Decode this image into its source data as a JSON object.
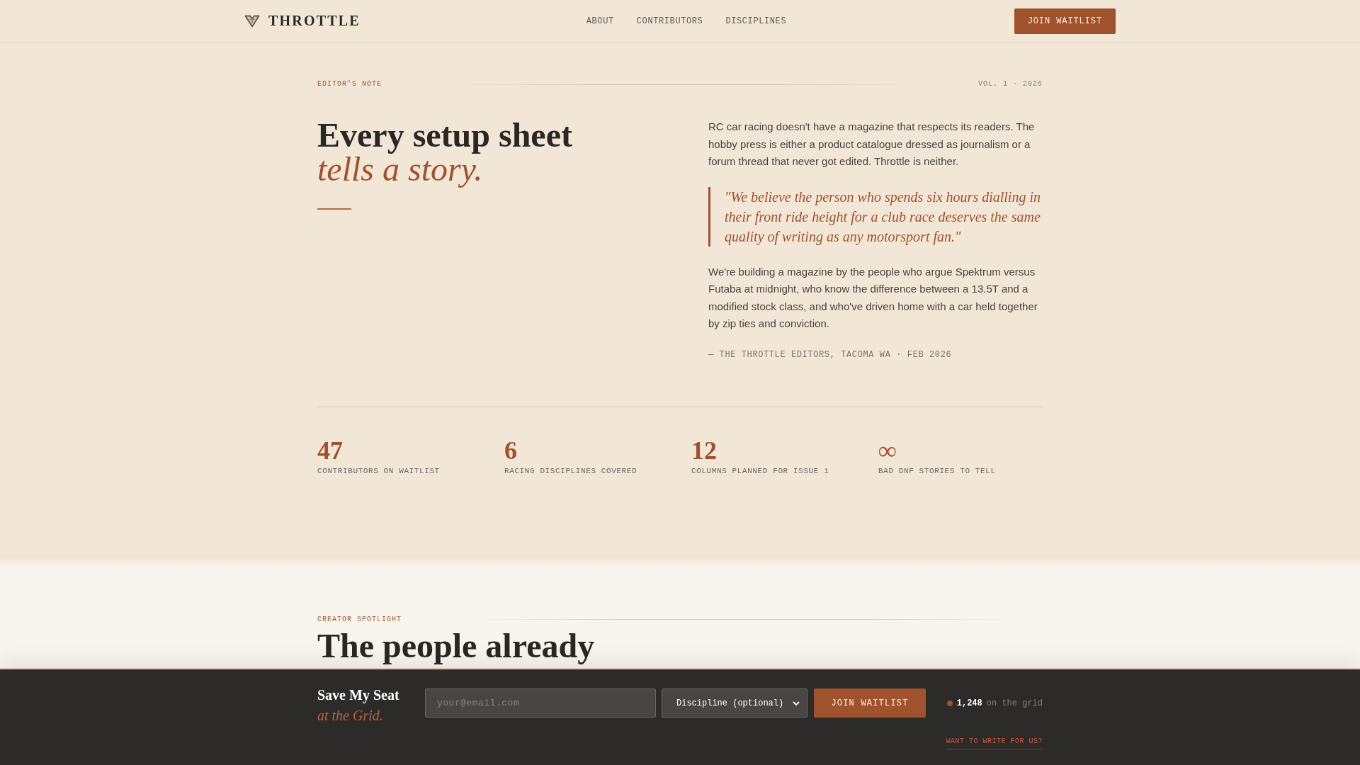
{
  "header": {
    "brand": "THROTTLE",
    "nav": [
      "ABOUT",
      "CONTRIBUTORS",
      "DISCIPLINES"
    ],
    "cta": "JOIN WAITLIST"
  },
  "editors_note": {
    "label": "EDITOR'S NOTE",
    "volume": "VOL. 1 · 2026",
    "headline": "Every setup sheet *tells a story.*",
    "body": [
      {
        "kind": "paragraph",
        "text": "RC car racing doesn't have a magazine that respects its readers. The hobby press is either a product catalogue dressed as journalism or a forum thread that never got edited. Throttle is neither."
      },
      {
        "kind": "quote",
        "text": "\"We believe the person who spends six hours dialling in their front ride height for a club race deserves the same quality of writing as any motorsport fan.\""
      },
      {
        "kind": "paragraph",
        "text": "We're building a magazine by the people who argue Spektrum versus Futaba at midnight, who know the difference between a 13.5T and a modified stock class, and who've driven home with a car held together by zip ties and conviction."
      }
    ],
    "signature": "— THE THROTTLE EDITORS, TACOMA WA · FEB 2026"
  },
  "stats": [
    {
      "value": "47",
      "label": "CONTRIBUTORS ON WAITLIST"
    },
    {
      "value": "6",
      "label": "RACING DISCIPLINES COVERED"
    },
    {
      "value": "12",
      "label": "COLUMNS PLANNED FOR ISSUE 1"
    },
    {
      "value": "∞",
      "label": "BAD DNF STORIES TO TELL"
    }
  ],
  "spotlight": {
    "label": "CREATOR SPOTLIGHT",
    "heading": "The people already"
  },
  "signup_bar": {
    "title": "Save My Seat *at the Grid.*",
    "email": {
      "placeholder": "your@email.com"
    },
    "discipline": {
      "value": "Discipline (optional)"
    },
    "button": "JOIN WAITLIST",
    "count": "1,248",
    "count_label": "on the grid",
    "link": "WANT TO WRITE FOR US?"
  }
}
